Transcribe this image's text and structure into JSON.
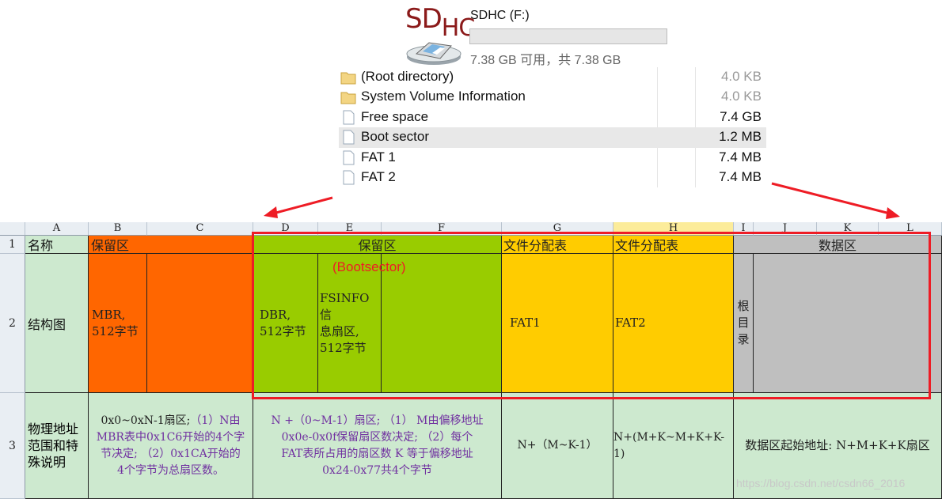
{
  "drive": {
    "logo_sd": "SD",
    "logo_hc": "HC",
    "name": "SDHC (F:)",
    "usage_fraction": 0,
    "space_text": "7.38 GB 可用，共 7.38 GB"
  },
  "files": [
    {
      "icon": "folder-icon",
      "name": "(Root directory)",
      "size": "4.0 KB",
      "dim": true,
      "selected": false
    },
    {
      "icon": "folder-icon",
      "name": "System Volume Information",
      "size": "4.0 KB",
      "dim": true,
      "selected": false
    },
    {
      "icon": "file-icon",
      "name": "Free space",
      "size": "7.4 GB",
      "dim": false,
      "selected": false
    },
    {
      "icon": "file-icon",
      "name": "Boot sector",
      "size": "1.2 MB",
      "dim": false,
      "selected": true
    },
    {
      "icon": "file-icon",
      "name": "FAT 1",
      "size": "7.4 MB",
      "dim": false,
      "selected": false
    },
    {
      "icon": "file-icon",
      "name": "FAT 2",
      "size": "7.4 MB",
      "dim": false,
      "selected": false
    }
  ],
  "sheet": {
    "columns": [
      "A",
      "B",
      "C",
      "D",
      "E",
      "F",
      "G",
      "H",
      "I",
      "J",
      "K",
      "L"
    ],
    "rows": [
      "1",
      "2",
      "3"
    ],
    "row1": {
      "a": "名称",
      "b": "保留区",
      "def": "保留区",
      "g": "文件分配表",
      "h": "文件分配表",
      "ijkl": "数据区"
    },
    "row2": {
      "a": "结构图",
      "b": "MBR,\n512字节",
      "d": "DBR,\n512字节",
      "e": "FSINFO信\n息扇区,\n512字节",
      "g": "FAT1",
      "h": "FAT2",
      "i": "根\n目\n录"
    },
    "row3": {
      "a": "物理地址\n范围和特\n殊说明",
      "bc_1": "0x0~0xN-1扇区;",
      "bc_2": "（1）N由",
      "bc_3": "MBR表中0x1C6开始的4个字",
      "bc_4": "节决定;  （2）0x1CA开始的",
      "bc_5": "4个字节为总扇区数。",
      "def_1": "N +（0~M-1）扇区;  （1） M由偏移地址",
      "def_2": "0x0e-0x0f保留扇区数决定;  （2）每个",
      "def_3": "FAT表所占用的扇区数 K 等于偏移地址",
      "def_4": "0x24-0x77共4个字节",
      "g": "N+（M~K-1）",
      "h": "N+(M+K~M+K+K-1)",
      "ijkl": "数据区起始地址: N+M+K+K扇区"
    }
  },
  "annotations": {
    "bootsector": "(Bootsector)",
    "highlight_color": "#ee1c25"
  },
  "watermark": "https://blog.csdn.net/csdn66_2016",
  "colors": {
    "orange": "#ff6600",
    "lime": "#99cc00",
    "yellow": "#ffcc00",
    "gray": "#bfbfbf",
    "green": "#cde9cf",
    "purple": "#7030a0",
    "red": "#c00000"
  }
}
